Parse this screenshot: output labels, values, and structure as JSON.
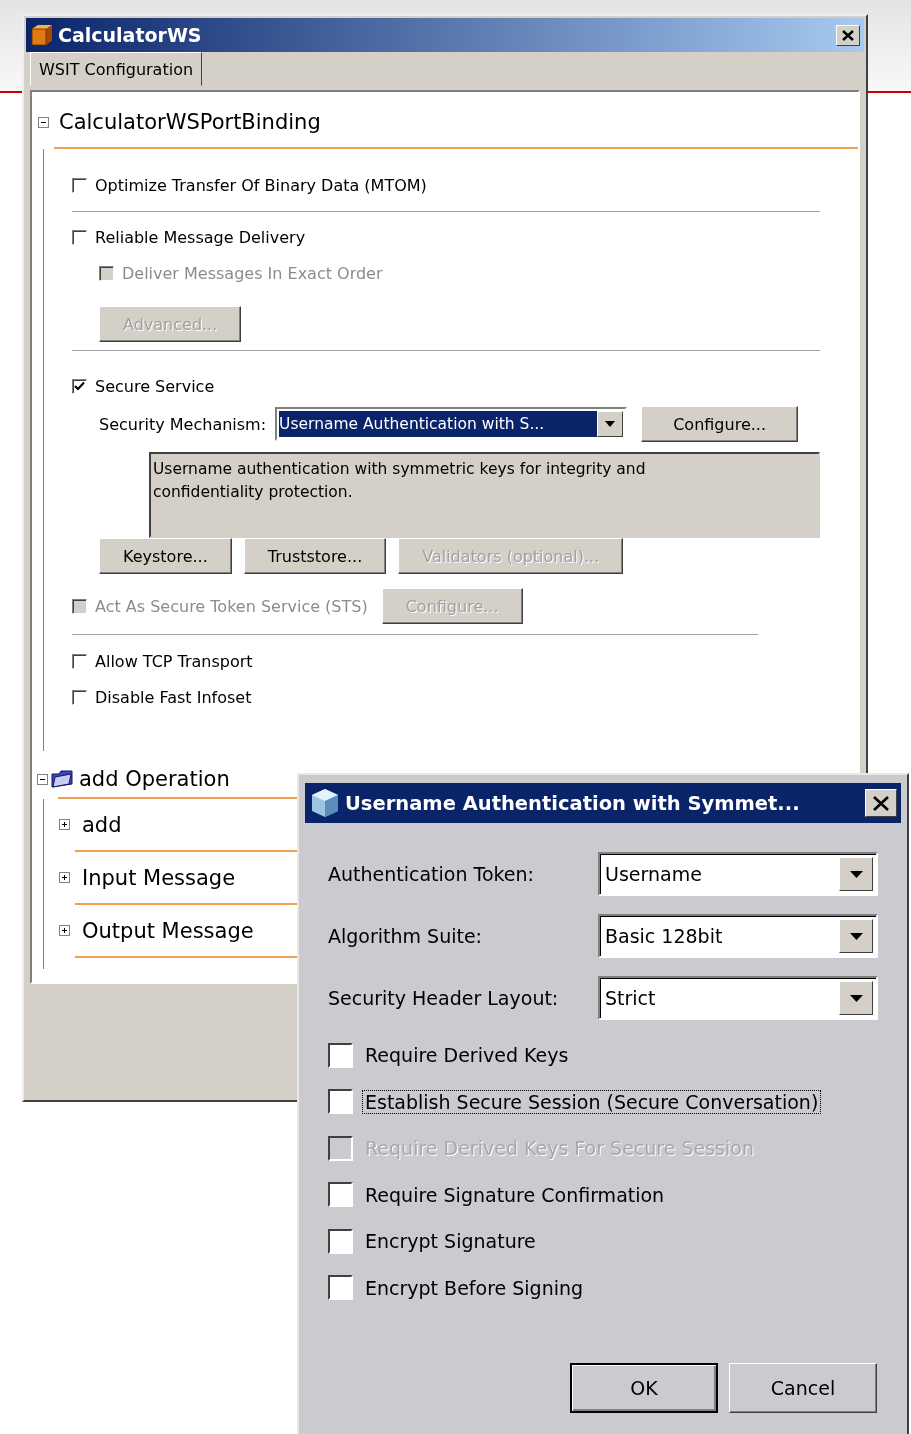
{
  "window": {
    "title": "CalculatorWS"
  },
  "tabs": [
    {
      "label": "WSIT Configuration",
      "selected": true
    }
  ],
  "binding": {
    "title": "CalculatorWSPortBinding",
    "expanded": true,
    "sections": [
      {
        "rows": [
          {
            "kind": "checkbox",
            "label": "Optimize Transfer Of Binary Data (MTOM)",
            "checked": false,
            "disabled": false
          }
        ]
      },
      {
        "rows": [
          {
            "kind": "checkbox",
            "label": "Reliable Message Delivery",
            "checked": false,
            "disabled": false,
            "children": [
              {
                "kind": "checkbox",
                "label": "Deliver Messages In Exact Order",
                "checked": false,
                "disabled": true
              },
              {
                "kind": "buttons",
                "buttons": [
                  {
                    "label": "Advanced...",
                    "disabled": true
                  }
                ]
              }
            ]
          }
        ]
      },
      {
        "rows": [
          {
            "kind": "checkbox",
            "label": "Secure Service",
            "checked": true,
            "disabled": false,
            "children": [
              {
                "kind": "combo",
                "label": "Security Mechanism:",
                "value": "Username Authentication with S...",
                "button": {
                  "label": "Configure...",
                  "disabled": false
                }
              },
              {
                "kind": "description",
                "text": "Username authentication with symmetric keys for integrity and confidentiality protection."
              },
              {
                "kind": "buttons",
                "buttons": [
                  {
                    "label": "Keystore...",
                    "disabled": false
                  },
                  {
                    "label": "Truststore...",
                    "disabled": false
                  },
                  {
                    "label": "Validators (optional)...",
                    "disabled": true
                  }
                ]
              }
            ]
          },
          {
            "kind": "checkbox",
            "label": "Act As Secure Token Service (STS)",
            "checked": false,
            "disabled": true,
            "button": {
              "label": "Configure...",
              "disabled": true
            }
          }
        ]
      },
      {
        "rows": [
          {
            "kind": "checkbox",
            "label": "Allow TCP Transport",
            "checked": false,
            "disabled": false
          },
          {
            "kind": "checkbox",
            "label": "Disable Fast Infoset",
            "checked": false,
            "disabled": false
          }
        ]
      }
    ]
  },
  "operation": {
    "title": "add Operation",
    "expanded": true,
    "children": [
      {
        "label": "add",
        "expanded": false
      },
      {
        "label": "Input Message",
        "expanded": false
      },
      {
        "label": "Output Message",
        "expanded": false
      }
    ]
  },
  "dialog": {
    "title": "Username Authentication with Symmet...",
    "fields": [
      {
        "label": "Authentication Token:",
        "value": "Username"
      },
      {
        "label": "Algorithm Suite:",
        "value": "Basic 128bit"
      },
      {
        "label": "Security Header Layout:",
        "value": "Strict"
      }
    ],
    "checkboxes": [
      {
        "label": "Require Derived Keys",
        "checked": false,
        "disabled": false,
        "focused": false
      },
      {
        "label": "Establish Secure Session (Secure Conversation)",
        "checked": false,
        "disabled": false,
        "focused": true
      },
      {
        "label": "Require Derived Keys For Secure Session",
        "checked": false,
        "disabled": true,
        "focused": false
      },
      {
        "label": "Require Signature Confirmation",
        "checked": false,
        "disabled": false,
        "focused": false
      },
      {
        "label": "Encrypt Signature",
        "checked": false,
        "disabled": false,
        "focused": false
      },
      {
        "label": "Encrypt Before Signing",
        "checked": false,
        "disabled": false,
        "focused": false
      }
    ],
    "buttons": [
      {
        "label": "OK",
        "default": true
      },
      {
        "label": "Cancel",
        "default": false
      }
    ]
  }
}
